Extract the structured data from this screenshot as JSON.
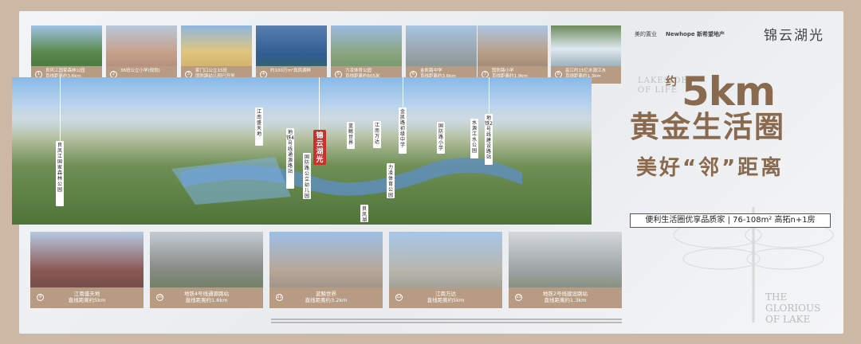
{
  "brand": {
    "project_logo": "锦云湖光",
    "partner1": "美的置业",
    "partner2": "Newhope 新希望地产"
  },
  "headline": {
    "approx": "约",
    "distance": "5km",
    "lakeside": "LAKESIDE OF LIFE",
    "line1": "黄金生活圈",
    "line2": "美好“邻”距离",
    "tagline": "便利生活圈优享品质家 | 76-108m² 高拓n+1房",
    "ghost_text": "THE GLORIOUS OF LAKE"
  },
  "top_cards": [
    {
      "num": "1",
      "line1": "良风江国家森林公园",
      "line2": "直线距离约3.6km"
    },
    {
      "num": "2",
      "line1": "36班公立小学(规划)",
      "line2": ""
    },
    {
      "num": "3",
      "line1": "家门口公立15班",
      "line2": "国防路幼儿园已开学"
    },
    {
      "num": "4",
      "line1": "约100万m²良凤湖畔",
      "line2": ""
    },
    {
      "num": "5",
      "line1": "力凌体育公园",
      "line2": "直线距离约605米"
    },
    {
      "num": "6",
      "line1": "金凯路中学",
      "line2": "直线距离约3.6km"
    },
    {
      "num": "7",
      "line1": "国防路小学",
      "line2": "直线距离约1.9km"
    },
    {
      "num": "8",
      "line1": "邕江约15亿水源江水",
      "line2": "直线距离约1.3km"
    }
  ],
  "bottom_cards": [
    {
      "num": "9",
      "line1": "江南盛天地",
      "line2": "直线距离约5km"
    },
    {
      "num": "10",
      "line1": "地铁4号线通源路站",
      "line2": "直线距离约1.6km"
    },
    {
      "num": "11",
      "line1": "蓝鲸世界",
      "line2": "直线距离约3.2km"
    },
    {
      "num": "12",
      "line1": "江南万达",
      "line2": "直线距离约5km"
    },
    {
      "num": "13",
      "line1": "地铁2号线建设路站",
      "line2": "直线距离约1.3km"
    }
  ],
  "map_labels": [
    "良凤江国家森林公园",
    "江南盛天地",
    "地铁4号线通源路站",
    "国防路公立幼儿园",
    "锦云湖光",
    "蓝鲸世界",
    "江南万达",
    "金凯路初级中学",
    "力凌体育公园",
    "国防路小学",
    "水源江水公园",
    "地铁2号线建设路站",
    "良凤湖"
  ],
  "colors": {
    "accent": "#8a6a4e",
    "caption_bg": "#b79b82",
    "pin": "#c8322d"
  }
}
